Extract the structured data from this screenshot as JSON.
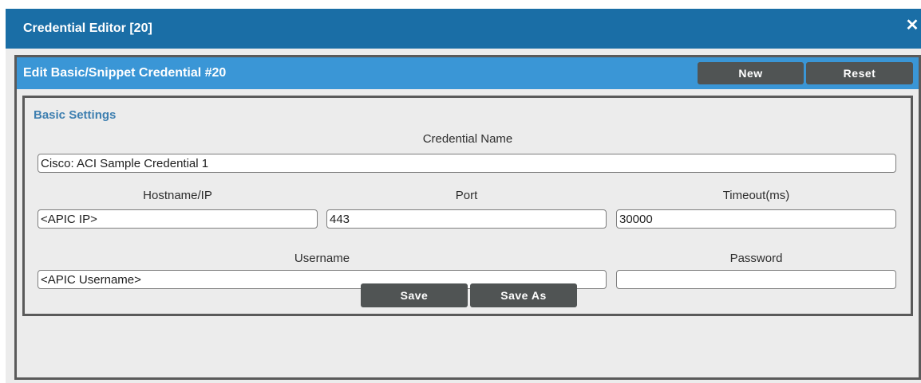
{
  "window": {
    "title": "Credential Editor [20]",
    "close_glyph": "✕",
    "close_icon": "close-icon"
  },
  "panel": {
    "title": "Edit Basic/Snippet Credential #20",
    "new_label": "New",
    "reset_label": "Reset"
  },
  "basic_settings": {
    "title": "Basic Settings",
    "credential_name": {
      "label": "Credential Name",
      "value": "Cisco: ACI Sample Credential 1"
    },
    "hostname": {
      "label": "Hostname/IP",
      "value": "<APIC IP>"
    },
    "port": {
      "label": "Port",
      "value": "443"
    },
    "timeout": {
      "label": "Timeout(ms)",
      "value": "30000"
    },
    "username": {
      "label": "Username",
      "value": "<APIC Username>"
    },
    "password": {
      "label": "Password",
      "value": ""
    }
  },
  "footer": {
    "save_label": "Save",
    "save_as_label": "Save As"
  },
  "colors": {
    "titlebar": "#1a6ea6",
    "panel_header": "#3a96d6",
    "button": "#505454",
    "section_title": "#3e7fb0"
  }
}
